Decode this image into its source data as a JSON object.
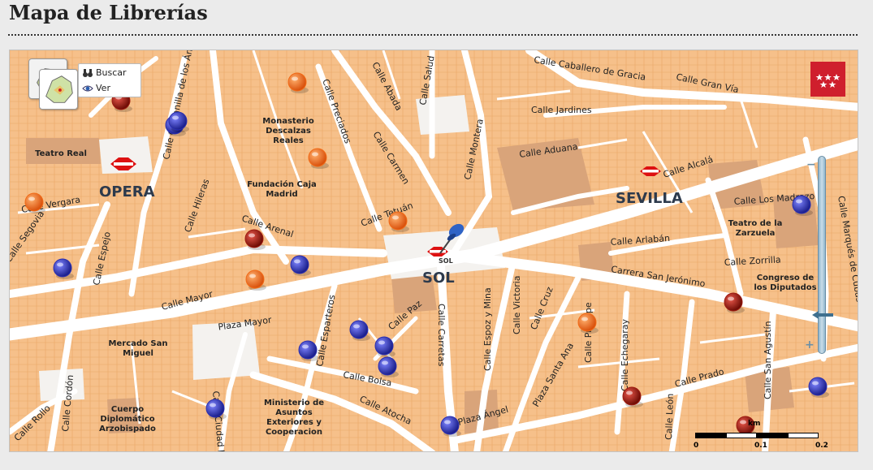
{
  "page": {
    "title": "Mapa de Librerías"
  },
  "toolbar": {
    "search_label": "Buscar",
    "view_label": "Ver"
  },
  "map": {
    "districts": [
      {
        "label": "OPERA",
        "font": 18
      },
      {
        "label": "SEVILLA",
        "font": 18
      },
      {
        "label": "SOL",
        "font": 18
      }
    ],
    "places": [
      {
        "lines": [
          "Teatro Real"
        ]
      },
      {
        "lines": [
          "Monasterio",
          "Descalzas",
          "Reales"
        ]
      },
      {
        "lines": [
          "Fundación Caja",
          "Madrid"
        ]
      },
      {
        "lines": [
          "Teatro de la",
          "Zarzuela"
        ]
      },
      {
        "lines": [
          "Congreso de",
          "los Diputados"
        ]
      },
      {
        "lines": [
          "Mercado San",
          "Miguel"
        ]
      },
      {
        "lines": [
          "Ministerio de",
          "Asuntos",
          "Exteriores y",
          "Cooperacion"
        ]
      },
      {
        "lines": [
          "Cuerpo",
          "Diplomático",
          "Arzobispado"
        ]
      },
      {
        "lines": [
          "Plaza Mayor"
        ]
      }
    ],
    "streets": [
      "Calle Caballero de Gracia",
      "Calle Gran Vía",
      "Calle Jardines",
      "Calle Aduana",
      "Calle Alcalá",
      "Calle Los Madrazo",
      "Calle Arlabán",
      "Calle Zorrilla",
      "Carrera San Jerónimo",
      "Calle Prado",
      "Calle Echegaray",
      "Calle Cruz",
      "Calle Príncipe",
      "Calle Victoria",
      "Calle Espoz y Mina",
      "Calle Carretas",
      "Plaza Santa Ana",
      "Calle Montera",
      "Calle Salud",
      "Calle Abada",
      "Calle Preciados",
      "Calle Carmen",
      "Calle Tetuán",
      "Calle Arenal",
      "Calle Hileras",
      "Calle Espejo",
      "Calle Mayor",
      "Calle Esparteros",
      "Calle Bolsa",
      "Calle Atocha",
      "Plaza Ángel",
      "Calle León",
      "Calle San Agustín",
      "Calle Marqués de Cubas",
      "Calle Vergara",
      "Calle Costanilla de los Ángeles",
      "Calle Cordón",
      "Calle Rollo",
      "Calle Ciudad Rodrigo",
      "Calle Paz",
      "Calle Segovia"
    ],
    "metro_label": "SOL",
    "marker_colors": {
      "blue": "#2b2fb0",
      "orange": "#f26a16",
      "red": "#9e1b10"
    },
    "markers": [
      {
        "color": "blue"
      },
      {
        "color": "blue"
      },
      {
        "color": "blue"
      },
      {
        "color": "blue"
      },
      {
        "color": "blue"
      },
      {
        "color": "blue"
      },
      {
        "color": "blue"
      },
      {
        "color": "blue"
      },
      {
        "color": "blue"
      },
      {
        "color": "blue"
      },
      {
        "color": "blue"
      },
      {
        "color": "blue"
      },
      {
        "color": "orange"
      },
      {
        "color": "orange"
      },
      {
        "color": "orange"
      },
      {
        "color": "orange"
      },
      {
        "color": "orange"
      },
      {
        "color": "orange"
      },
      {
        "color": "red"
      },
      {
        "color": "red"
      },
      {
        "color": "red"
      },
      {
        "color": "red"
      },
      {
        "color": "red"
      }
    ]
  },
  "scale": {
    "unit": "km",
    "ticks": [
      "0",
      "0.1",
      "0.2"
    ]
  }
}
